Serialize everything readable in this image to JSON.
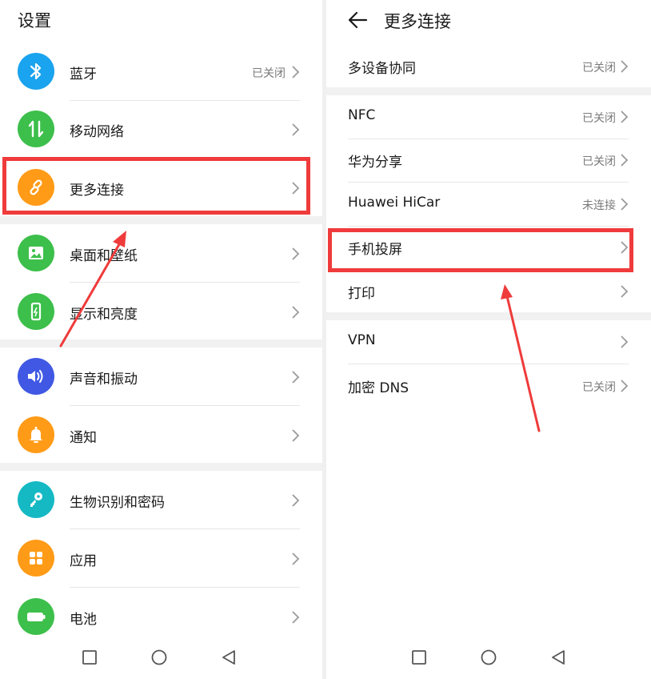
{
  "left": {
    "title": "设置",
    "items": [
      {
        "label": "蓝牙",
        "value": "已关闭",
        "icon": "bluetooth-icon",
        "color": "#1aa3ee"
      },
      {
        "label": "移动网络",
        "value": "",
        "icon": "mobile-data-icon",
        "color": "#3dbf4b"
      },
      {
        "label": "更多连接",
        "value": "",
        "icon": "link-icon",
        "color": "#ff9b17"
      },
      {
        "label": "桌面和壁纸",
        "value": "",
        "icon": "wallpaper-icon",
        "color": "#3dbf4b"
      },
      {
        "label": "显示和亮度",
        "value": "",
        "icon": "display-icon",
        "color": "#3dbf4b"
      },
      {
        "label": "声音和振动",
        "value": "",
        "icon": "sound-icon",
        "color": "#4058e3"
      },
      {
        "label": "通知",
        "value": "",
        "icon": "bell-icon",
        "color": "#ff9b17"
      },
      {
        "label": "生物识别和密码",
        "value": "",
        "icon": "key-icon",
        "color": "#15b9c3"
      },
      {
        "label": "应用",
        "value": "",
        "icon": "apps-icon",
        "color": "#ff9b17"
      },
      {
        "label": "电池",
        "value": "",
        "icon": "battery-icon",
        "color": "#3dbf4b"
      }
    ]
  },
  "right": {
    "title": "更多连接",
    "items": [
      {
        "label": "多设备协同",
        "value": "已关闭"
      },
      {
        "label": "NFC",
        "value": "已关闭"
      },
      {
        "label": "华为分享",
        "value": "已关闭"
      },
      {
        "label": "Huawei HiCar",
        "value": "未连接"
      },
      {
        "label": "手机投屏",
        "value": ""
      },
      {
        "label": "打印",
        "value": ""
      },
      {
        "label": "VPN",
        "value": ""
      },
      {
        "label": "加密 DNS",
        "value": "已关闭"
      }
    ]
  },
  "annotation_color": "#ef3b3b"
}
